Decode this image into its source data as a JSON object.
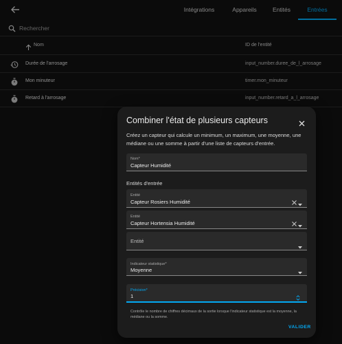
{
  "tabs": [
    {
      "label": "Intégrations"
    },
    {
      "label": "Appareils"
    },
    {
      "label": "Entités"
    },
    {
      "label": "Entrées"
    }
  ],
  "search": {
    "placeholder": "Rechercher"
  },
  "table": {
    "col_name": "Nom",
    "col_entity_id": "ID de l'entité",
    "rows": [
      {
        "icon": "history-icon",
        "name": "Durée de l'arrosage",
        "entity_id": "input_number.duree_de_l_arrosage"
      },
      {
        "icon": "timer-icon",
        "name": "Mon minuteur",
        "entity_id": "timer.mon_minuteur"
      },
      {
        "icon": "timer-icon",
        "name": "Retard à l'arrosage",
        "entity_id": "input_number.retard_a_l_arrosage"
      }
    ]
  },
  "dialog": {
    "title": "Combiner l'état de plusieurs capteurs",
    "description": "Créez un capteur qui calcule un minimum, un maximum, une moyenne, une médiane ou une somme à partir d'une liste de capteurs d'entrée.",
    "name_label": "Nom*",
    "name_value": "Capteur Humidité",
    "entities_section": "Entités d'entrée",
    "entities": [
      {
        "label": "Entité",
        "value": "Capteur Rosiers Humidité"
      },
      {
        "label": "Entité",
        "value": "Capteur Hortensia Humidité"
      }
    ],
    "empty_entity_label": "Entité",
    "stat_label": "Indicateur statistique*",
    "stat_value": "Moyenne",
    "precision_label": "Précision*",
    "precision_value": "1",
    "helper": "Contrôle le nombre de chiffres décimaux de la sortie lorsque l'indicateur statistique est la moyenne, la médiane ou la somme.",
    "submit": "VALIDER"
  },
  "colors": {
    "accent": "#03a9f4",
    "background": "#111111",
    "dialog": "#1c1c1c",
    "field": "#2a2a2a"
  }
}
